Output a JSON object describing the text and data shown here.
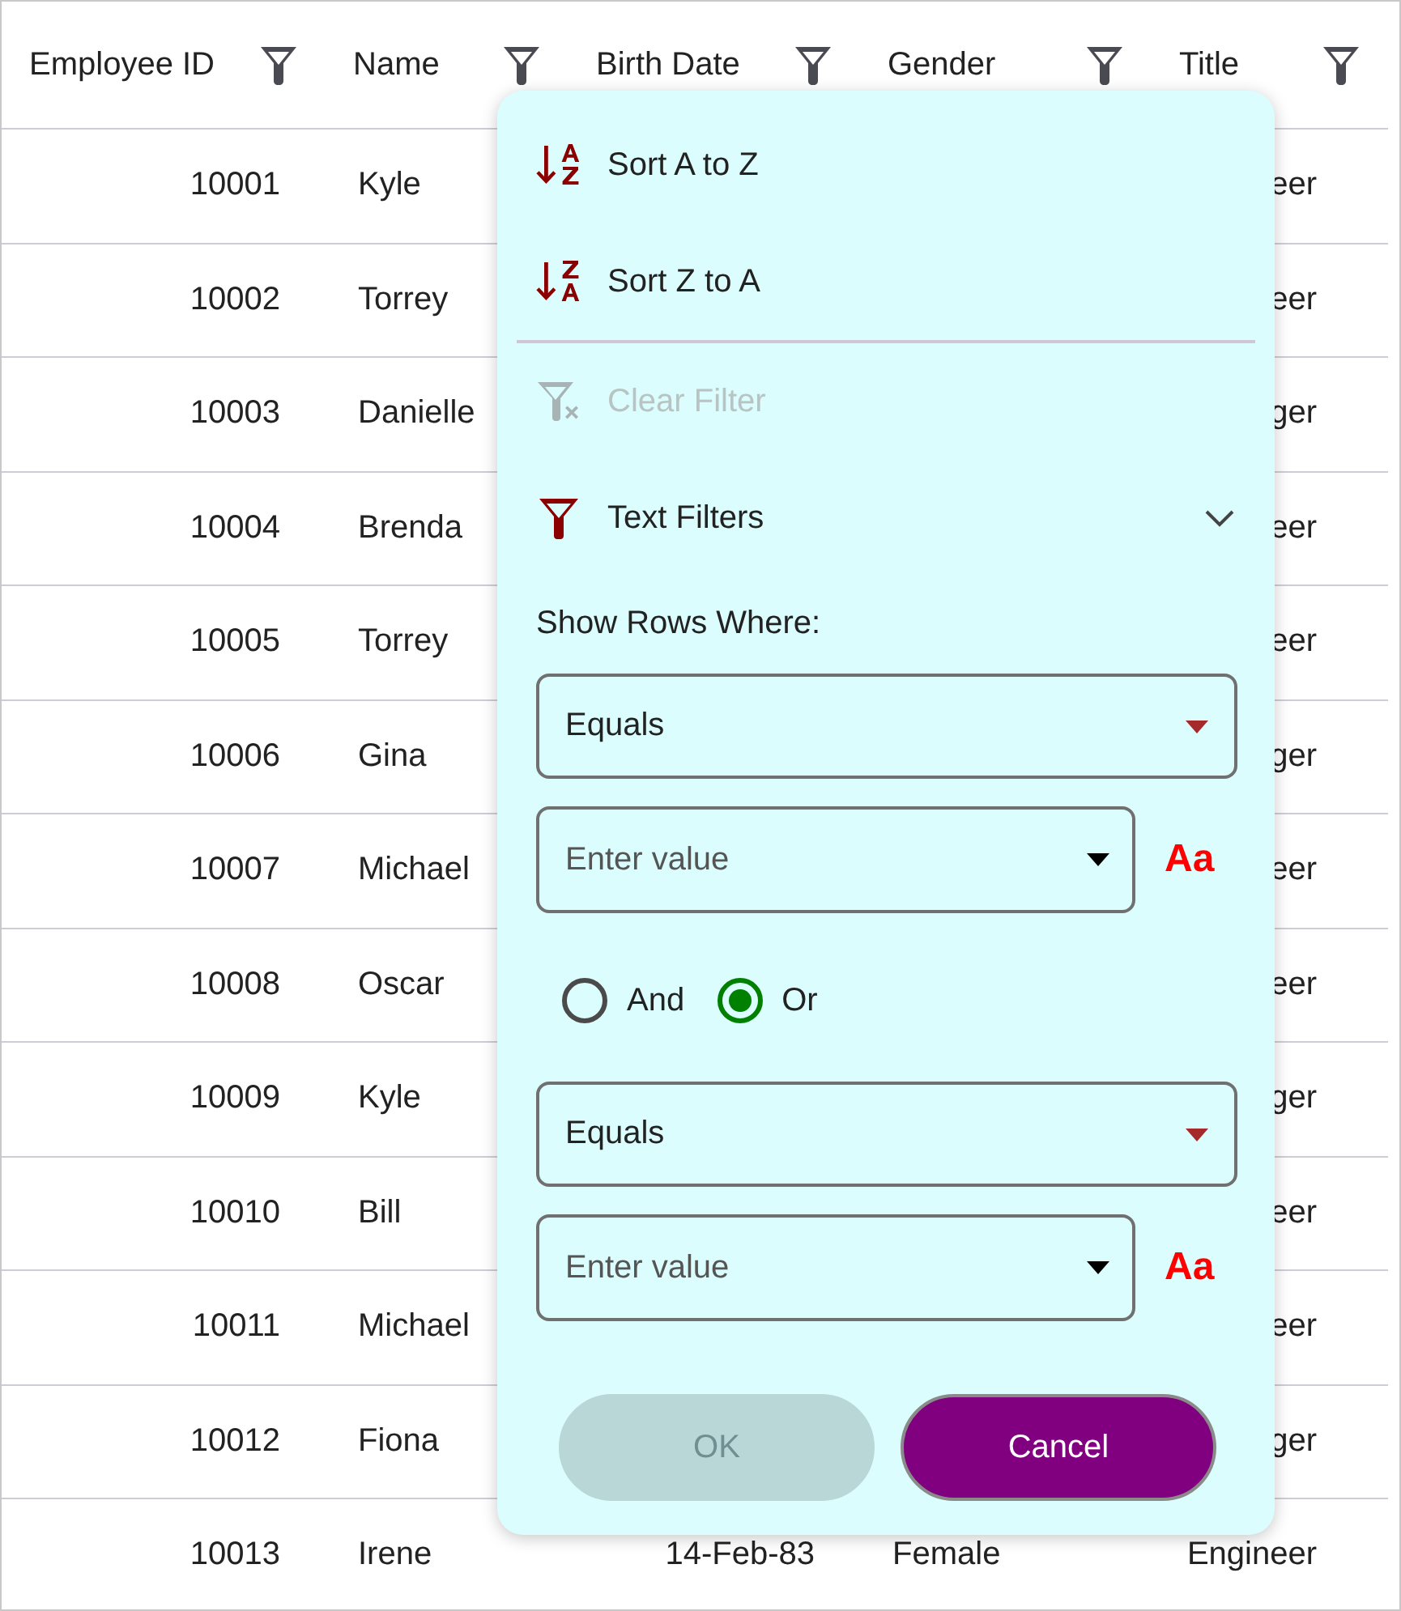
{
  "columns": [
    {
      "label": "Employee ID"
    },
    {
      "label": "Name"
    },
    {
      "label": "Birth Date"
    },
    {
      "label": "Gender"
    },
    {
      "label": "Title"
    }
  ],
  "rows": [
    {
      "employee_id": "10001",
      "name": "Kyle",
      "title": "eer"
    },
    {
      "employee_id": "10002",
      "name": "Torrey",
      "title": "eer"
    },
    {
      "employee_id": "10003",
      "name": "Danielle",
      "title": "ger"
    },
    {
      "employee_id": "10004",
      "name": "Brenda",
      "title": "eer"
    },
    {
      "employee_id": "10005",
      "name": "Torrey",
      "title": "eer"
    },
    {
      "employee_id": "10006",
      "name": "Gina",
      "title": "ger"
    },
    {
      "employee_id": "10007",
      "name": "Michael",
      "title": "eer"
    },
    {
      "employee_id": "10008",
      "name": "Oscar",
      "title": "eer"
    },
    {
      "employee_id": "10009",
      "name": "Kyle",
      "title": "ger"
    },
    {
      "employee_id": "10010",
      "name": "Bill",
      "title": "eer"
    },
    {
      "employee_id": "10011",
      "name": "Michael",
      "title": "eer"
    },
    {
      "employee_id": "10012",
      "name": "Fiona",
      "title": "ger"
    },
    {
      "employee_id": "10013",
      "name": "Irene",
      "birth_date": "14-Feb-83",
      "gender": "Female",
      "title": "Engineer"
    }
  ],
  "filter_menu": {
    "items": [
      {
        "kind": "sort_asc",
        "label": "Sort A to Z",
        "disabled": false
      },
      {
        "kind": "sort_desc",
        "label": "Sort Z to A",
        "disabled": false
      },
      {
        "kind": "clear",
        "label": "Clear Filter",
        "disabled": true
      },
      {
        "kind": "text_filters",
        "label": "Text Filters",
        "disabled": false,
        "expanded": true
      }
    ],
    "section_label": "Show Rows Where:",
    "conditions": [
      {
        "operator": "Equals",
        "placeholder": "Enter value",
        "match_case": "Aa"
      },
      {
        "operator": "Equals",
        "placeholder": "Enter value",
        "match_case": "Aa"
      }
    ],
    "logic": [
      {
        "label": "And",
        "selected": false
      },
      {
        "label": "Or",
        "selected": true
      }
    ],
    "buttons": [
      {
        "kind": "ok",
        "label": "OK",
        "disabled": true
      },
      {
        "kind": "cancel",
        "label": "Cancel",
        "disabled": false
      }
    ]
  }
}
